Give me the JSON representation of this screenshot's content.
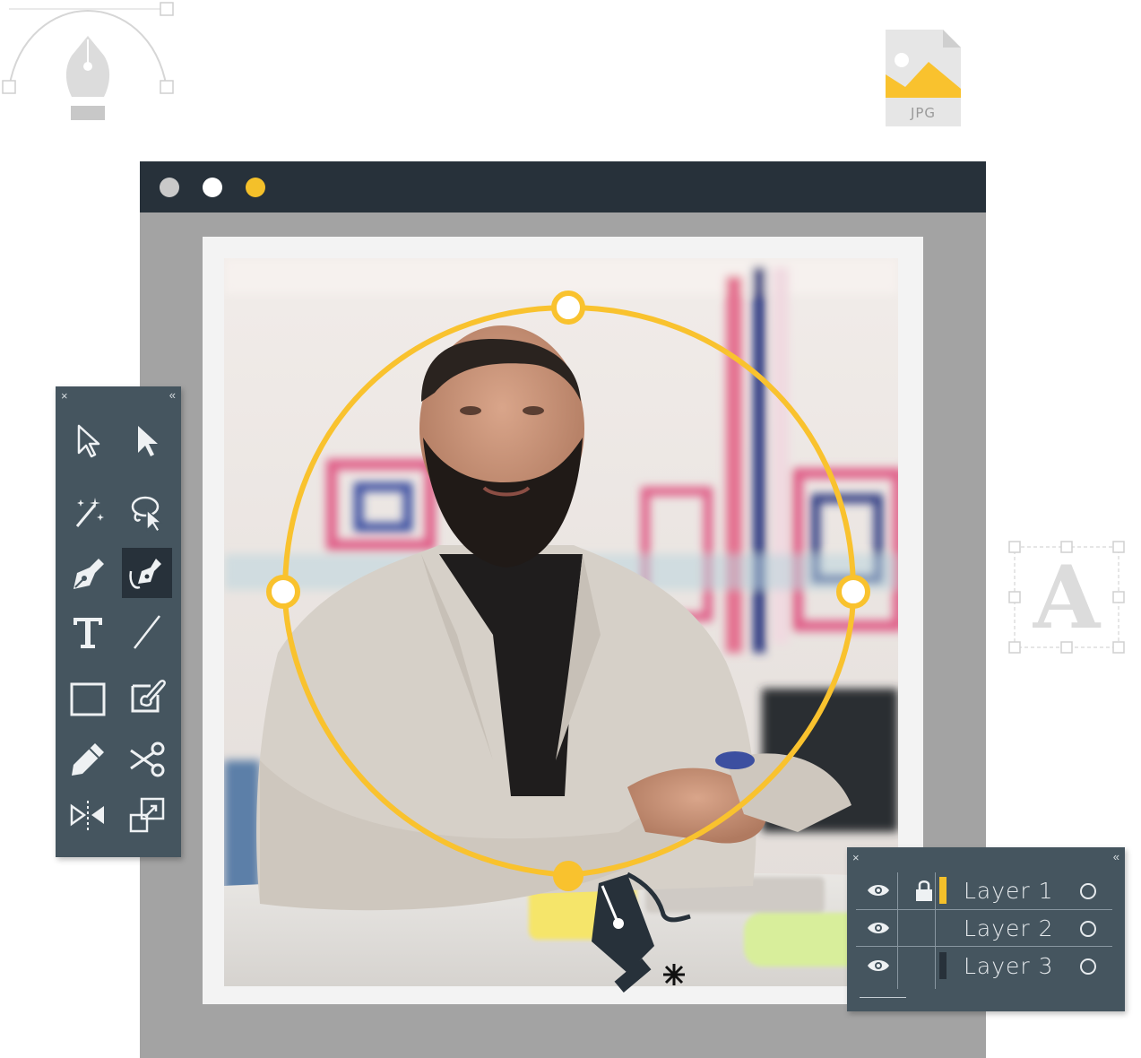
{
  "window": {
    "title_dots": [
      {
        "name": "close",
        "color": "#c9c9c9"
      },
      {
        "name": "minimize",
        "color": "#ffffff"
      },
      {
        "name": "maximize",
        "color": "#f4c02a"
      }
    ]
  },
  "file_icon": {
    "label": "JPG"
  },
  "type_icon": {
    "letter": "A"
  },
  "tools_panel": {
    "close_glyph": "×",
    "collapse_glyph": "«",
    "tools": [
      {
        "name": "selection-tool",
        "icon": "arrow-outline-icon"
      },
      {
        "name": "direct-selection-tool",
        "icon": "arrow-solid-icon"
      },
      {
        "name": "magic-wand-tool",
        "icon": "magic-wand-icon"
      },
      {
        "name": "lasso-tool",
        "icon": "lasso-icon"
      },
      {
        "name": "pen-tool",
        "icon": "pen-nib-icon"
      },
      {
        "name": "curvature-tool",
        "icon": "curvature-pen-icon",
        "active": true
      },
      {
        "name": "type-tool",
        "icon": "type-icon",
        "glyph": "T"
      },
      {
        "name": "line-tool",
        "icon": "line-icon"
      },
      {
        "name": "rectangle-tool",
        "icon": "rectangle-icon"
      },
      {
        "name": "paintbrush-tool",
        "icon": "paintbrush-icon"
      },
      {
        "name": "pencil-tool",
        "icon": "pencil-icon"
      },
      {
        "name": "scissors-tool",
        "icon": "scissors-icon"
      },
      {
        "name": "reflect-tool",
        "icon": "reflect-icon"
      },
      {
        "name": "scale-tool",
        "icon": "scale-icon"
      }
    ]
  },
  "layers_panel": {
    "close_glyph": "×",
    "collapse_glyph": "«",
    "layers": [
      {
        "name": "Layer 1",
        "visible": true,
        "locked": true,
        "color": "#f4c02a"
      },
      {
        "name": "Layer 2",
        "visible": true,
        "locked": false,
        "color": ""
      },
      {
        "name": "Layer 3",
        "visible": true,
        "locked": false,
        "color": "#27313a"
      }
    ]
  },
  "colors": {
    "accent": "#f9c22e",
    "panel": "#45555f",
    "titlebar": "#27313a"
  }
}
